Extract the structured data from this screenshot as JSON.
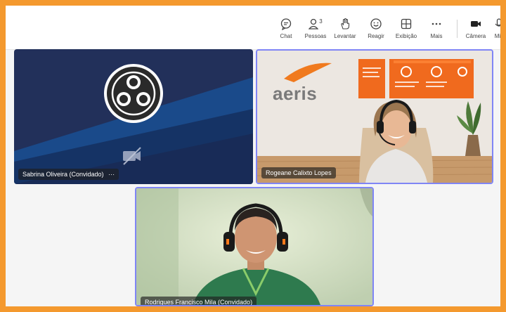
{
  "toolbar": {
    "chat_label": "Chat",
    "people_label": "Pessoas",
    "people_count": "3",
    "raise_label": "Levantar",
    "react_label": "Reagir",
    "view_label": "Exibição",
    "more_label": "Mais",
    "camera_label": "Câmera",
    "mic_label": "Mic"
  },
  "participants": [
    {
      "name": "Sabrina Oliveira (Convidado)",
      "more": "···"
    },
    {
      "name": "Rogeane Calixto Lopes",
      "logo_text": "aeris"
    },
    {
      "name": "Rodrigues Francisco Mila (Convidado)"
    }
  ],
  "colors": {
    "frame_border": "#f4992e",
    "selected_outline": "#7f85f5",
    "tile_dark": "#1f2e5a",
    "aeris_orange": "#f06a1e"
  }
}
